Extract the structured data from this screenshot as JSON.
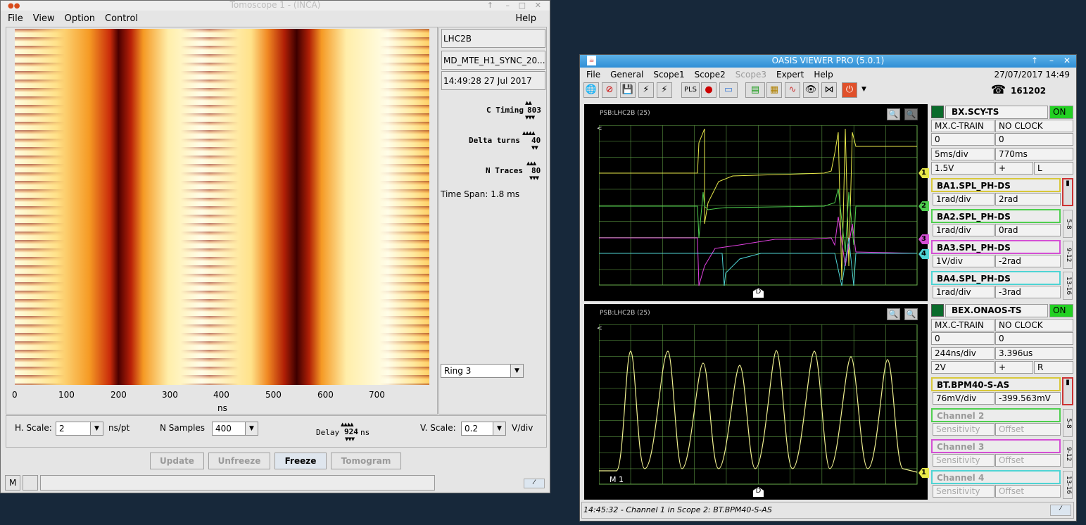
{
  "tomo": {
    "title": "Tomoscope 1 - (INCA)",
    "menu": [
      "File",
      "View",
      "Option",
      "Control"
    ],
    "help": "Help",
    "info": [
      "LHC2B",
      "MD_MTE_H1_SYNC_20...",
      "14:49:28 27 Jul 2017"
    ],
    "c_timing_label": "C Timing",
    "c_timing_value": "803",
    "delta_turns_label": "Delta turns",
    "delta_turns_value": "40",
    "n_traces_label": "N Traces",
    "n_traces_value": "80",
    "time_span": "Time Span: 1.8 ms",
    "ring": "Ring 3",
    "x_ticks": [
      "0",
      "100",
      "200",
      "300",
      "400",
      "500",
      "600",
      "700"
    ],
    "x_unit": "ns",
    "hscale_label": "H. Scale:",
    "hscale_value": "2",
    "hscale_unit": "ns/pt",
    "nsamples_label": "N Samples",
    "nsamples_value": "400",
    "delay_label": "Delay",
    "delay_value": "924",
    "delay_unit": "ns",
    "vscale_label": "V. Scale:",
    "vscale_value": "0.2",
    "vscale_unit": "V/div",
    "buttons": [
      "Update",
      "Unfreeze",
      "Freeze",
      "Tomogram"
    ],
    "status_m": "M"
  },
  "oasis": {
    "title": "OASIS VIEWER PRO (5.0.1)",
    "menu": [
      "File",
      "General",
      "Scope1",
      "Scope2",
      "Scope3",
      "Expert",
      "Help"
    ],
    "datetime": "27/07/2017 14:49",
    "phone": "161202",
    "toolbar_pls": "PLS",
    "scope1": {
      "label": "PSB:LHC2B (25)",
      "device": "BX.SCY-TS",
      "state": "ON",
      "rows": [
        [
          "MX.C-TRAIN",
          "NO CLOCK"
        ],
        [
          "0",
          "0"
        ],
        [
          "5ms/div",
          "770ms"
        ]
      ],
      "row4": [
        "1.5V",
        "+",
        "L"
      ],
      "channels": [
        {
          "name": "BA1.SPL_PH-DS",
          "sens": "1rad/div",
          "off": "2rad",
          "color": "#e8d84a"
        },
        {
          "name": "BA2.SPL_PH-DS",
          "sens": "1rad/div",
          "off": "0rad",
          "color": "#4fcf4f"
        },
        {
          "name": "BA3.SPL_PH-DS",
          "sens": "1V/div",
          "off": "-2rad",
          "color": "#d44fd4"
        },
        {
          "name": "BA4.SPL_PH-DS",
          "sens": "1rad/div",
          "off": "-3rad",
          "color": "#4fd4d4"
        }
      ],
      "side": [
        "5-8",
        "9-12",
        "13-16"
      ]
    },
    "scope2": {
      "label": "PSB:LHC2B (25)",
      "device": "BEX.ONAOS-TS",
      "state": "ON",
      "rows": [
        [
          "MX.C-TRAIN",
          "NO CLOCK"
        ],
        [
          "0",
          "0"
        ],
        [
          "244ns/div",
          "3.396us"
        ]
      ],
      "row4": [
        "2V",
        "+",
        "R"
      ],
      "m1": "M 1",
      "channels": [
        {
          "name": "BT.BPM40-S-AS",
          "sens": "76mV/div",
          "off": "-399.563mV",
          "color": "#e8d84a"
        },
        {
          "name": "Channel 2",
          "sens": "Sensitivity",
          "off": "Offset",
          "color": "#4fcf4f"
        },
        {
          "name": "Channel 3",
          "sens": "Sensitivity",
          "off": "Offset",
          "color": "#d44fd4"
        },
        {
          "name": "Channel 4",
          "sens": "Sensitivity",
          "off": "Offset",
          "color": "#4fd4d4"
        }
      ],
      "side": [
        "5-8",
        "9-12",
        "13-16"
      ]
    },
    "status": "14:45:32 - Channel 1 in Scope 2: BT.BPM40-S-AS",
    "markers1": [
      "1",
      "2",
      "3",
      "4"
    ],
    "markers2": [
      "1"
    ],
    "d_marker": "D"
  }
}
